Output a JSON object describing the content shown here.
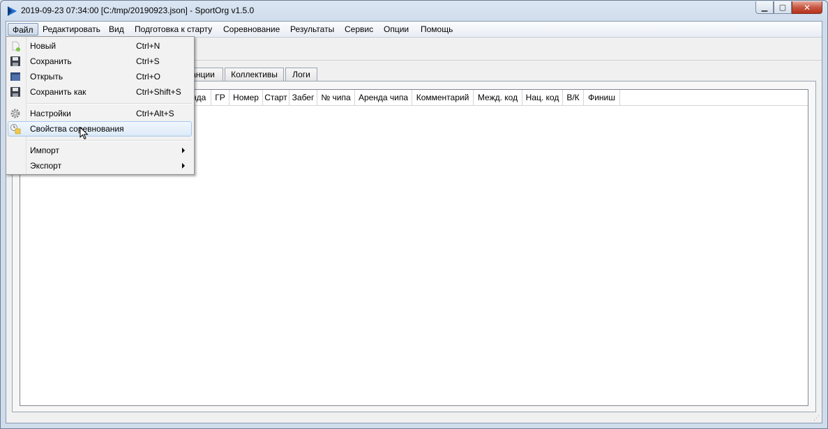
{
  "window": {
    "title": "2019-09-23 07:34:00 [C:/tmp/20190923.json] - SportOrg v1.5.0",
    "min_glyph": "▁",
    "max_glyph": "▢",
    "close_glyph": "✕"
  },
  "menubar": {
    "items": [
      "Файл",
      "Редактировать",
      "Вид",
      "Подготовка к старту",
      "Соревнование",
      "Результаты",
      "Сервис",
      "Опции",
      "Помощь"
    ],
    "active_index": 0
  },
  "tabs": [
    {
      "label": "анции"
    },
    {
      "label": "Коллективы"
    },
    {
      "label": "Логи"
    }
  ],
  "table": {
    "columns": [
      "нда",
      "ГР",
      "Номер",
      "Старт",
      "Забег",
      "№ чипа",
      "Аренда чипа",
      "Комментарий",
      "Межд. код",
      "Нац. код",
      "В/К",
      "Финиш"
    ]
  },
  "file_menu": {
    "items": [
      {
        "label": "Новый",
        "shortcut": "Ctrl+N",
        "icon": "new-file-icon"
      },
      {
        "label": "Сохранить",
        "shortcut": "Ctrl+S",
        "icon": "save-icon"
      },
      {
        "label": "Открыть",
        "shortcut": "Ctrl+O",
        "icon": "open-folder-icon"
      },
      {
        "label": "Сохранить как",
        "shortcut": "Ctrl+Shift+S",
        "icon": "save-as-icon"
      },
      {
        "label": "Настройки",
        "shortcut": "Ctrl+Alt+S",
        "icon": "gear-icon"
      },
      {
        "label": "Свойства соревнования",
        "shortcut": "",
        "icon": "properties-icon"
      },
      {
        "label": "Импорт",
        "shortcut": "",
        "submenu": true
      },
      {
        "label": "Экспорт",
        "shortcut": "",
        "submenu": true
      }
    ],
    "hovered_index": 5
  },
  "colors": {
    "accent": "#1f6fd1",
    "hover_bg": "#dceaf8",
    "hover_border": "#a8c7e8"
  }
}
